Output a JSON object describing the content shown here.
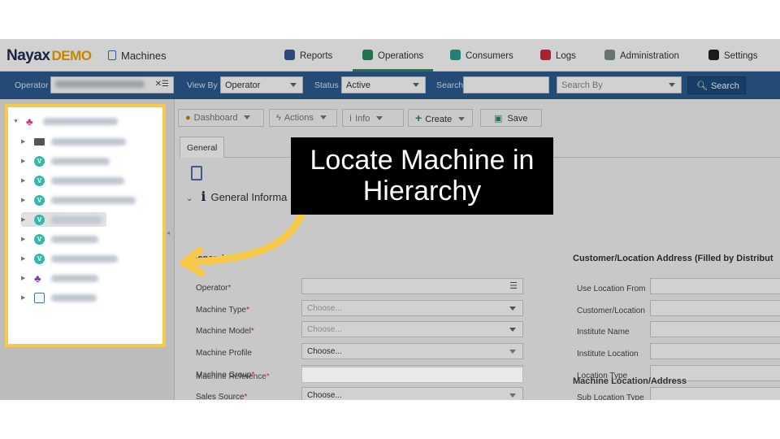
{
  "header": {
    "logo_main": "Nayax",
    "logo_demo": "DEMO",
    "module_title": "Machines"
  },
  "nav": {
    "items": [
      {
        "label": "Reports",
        "icon": "reports-icon",
        "color": "#3b5998"
      },
      {
        "label": "Operations",
        "icon": "operations-icon",
        "color": "#2d8a5e"
      },
      {
        "label": "Consumers",
        "icon": "consumers-icon",
        "color": "#2a9d8f"
      },
      {
        "label": "Logs",
        "icon": "logs-icon",
        "color": "#d62839"
      },
      {
        "label": "Administration",
        "icon": "administration-icon",
        "color": "#7f8c8d"
      },
      {
        "label": "Settings",
        "icon": "settings-icon",
        "color": "#222222"
      }
    ],
    "active": "Operations"
  },
  "toolbar": {
    "operator_label": "Operator",
    "view_by_label": "View By",
    "view_by_value": "Operator",
    "status_label": "Status",
    "status_value": "Active",
    "search_label": "Search",
    "search_by_placeholder": "Search By",
    "search_button": "Search"
  },
  "actions": {
    "dashboard": "Dashboard",
    "actions": "Actions",
    "info": "Info",
    "create": "Create",
    "save": "Save"
  },
  "tabs": {
    "general": "General"
  },
  "form": {
    "section_header": "General Informa",
    "general_title": "General",
    "left_fields": [
      {
        "label": "Operator",
        "required": "*",
        "value": ""
      },
      {
        "label": "Machine Type",
        "required": "*",
        "value": "Choose..."
      },
      {
        "label": "Machine Model",
        "required": "*",
        "value": "Choose..."
      },
      {
        "label": "Machine Profile",
        "required": "",
        "value": "Choose..."
      },
      {
        "label": "Machine Group",
        "required": "*",
        "value": ""
      },
      {
        "label": "Sales Source",
        "required": "*",
        "value": "Choose..."
      },
      {
        "label": "Machine Reference",
        "required": "*",
        "value": ""
      }
    ],
    "customer_title": "Customer/Location Address (Filled by Distribut",
    "right_fields": [
      {
        "label": "Use Location From"
      },
      {
        "label": "Customer/Location"
      },
      {
        "label": "Institute Name"
      },
      {
        "label": "Institute Location"
      },
      {
        "label": "Location Type"
      },
      {
        "label": "Sub Location Type"
      }
    ],
    "machine_location_title": "Machine Location/Address"
  },
  "callout": {
    "line1": "Locate Machine in",
    "line2": "Hierarchy",
    "highlight_color": "#f7c948"
  }
}
